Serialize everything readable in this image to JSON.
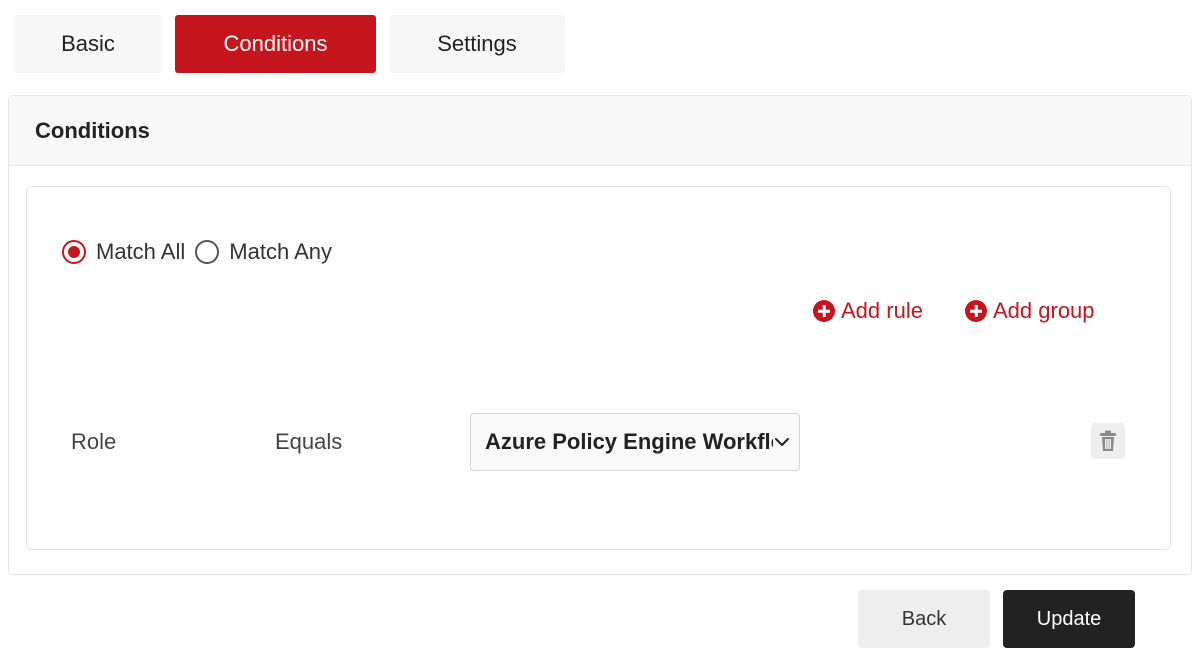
{
  "tabs": [
    {
      "label": "Basic",
      "active": false
    },
    {
      "label": "Conditions",
      "active": true
    },
    {
      "label": "Settings",
      "active": false
    }
  ],
  "card": {
    "title": "Conditions"
  },
  "match": {
    "options": [
      {
        "label": "Match All",
        "checked": true
      },
      {
        "label": "Match Any",
        "checked": false
      }
    ]
  },
  "actions": {
    "add_rule": "Add rule",
    "add_group": "Add group"
  },
  "rule": {
    "field": "Role",
    "operator": "Equals",
    "value": "Azure Policy Engine Workflow"
  },
  "footer": {
    "back": "Back",
    "update": "Update"
  },
  "colors": {
    "accent": "#c4161c",
    "dark": "#222222"
  },
  "icons": {
    "add": "plus-circle-icon",
    "dropdown": "chevron-down-icon",
    "delete": "trash-icon"
  }
}
